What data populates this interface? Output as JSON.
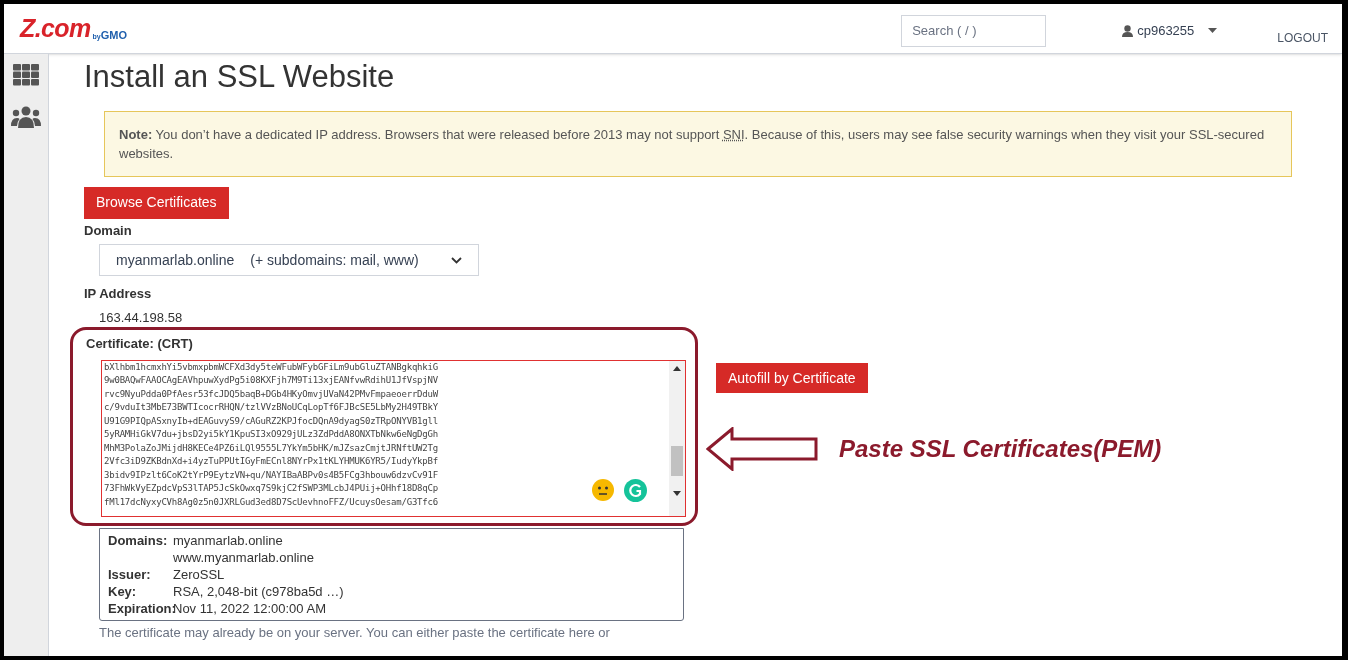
{
  "header": {
    "logo": {
      "main": "Z.com",
      "by": "by",
      "brand": "GMO"
    },
    "search": {
      "placeholder": "Search ( / )"
    },
    "user": "cp963255",
    "logout": "LOGOUT"
  },
  "title": "Install an SSL Website",
  "note": {
    "label": "Note:",
    "before": "You don’t have a dedicated IP address. Browsers that were released before 2013 may not support ",
    "abbr": "SNI",
    "after": ". Because of this, users may see false security warnings when they visit your SSL-secured websites."
  },
  "browse_button": "Browse Certificates",
  "domain": {
    "label": "Domain",
    "value": "myanmarlab.online",
    "suffix": "(+ subdomains: mail, www)"
  },
  "ip": {
    "label": "IP Address",
    "value": "163.44.198.58"
  },
  "certificate": {
    "label": "Certificate: (CRT)",
    "lines": [
      "bXlhbm1hcmxhYi5vbmxpbmWCFXd3dy5teWFubWFybGFiLm9ubGluZTANBgkqhkiG",
      "9w0BAQwFAAOCAgEAVhpuwXydPg5i08KXFjh7M9Ti13xjEANfvwRdihU1JfVspjNV",
      "rvc9NyuPdda0PfAesr53fcJDQ5baqB+DGb4HKyOmvjUVaN42PMvFmpaeoerrDduW",
      "c/9vduIt3MbE73BWTIcocrRHQN/tzlVVzBNoUCqLopTf6FJBcSE5LbMy2H49TBkY",
      "U91G9PIQpASxnyIb+dEAGuvyS9/cAGuRZ2KPJfocDQnA9dyagS0zTRpONYVB1gll",
      "5yRAMHiGkV7du+jbsD2yi5kY1KpuSI3xO929jULz3ZdPddA8ONXTbNkw6eNgDgGh",
      "MhM3PolaZoJMijdH8KECe4PZ6iLQl9555L7YkYm5bHK/mJZsazCmjtJRNftUW2Tg",
      "2Vfc3iD9ZKBdnXd+i4yzTuPPUtIGyFmECnl8NYrPx1tKLYHMUK6YR5/IudyYkpBf",
      "3bidv9IPzlt6CoK2tYrP9EytzVN+qu/NAYIBaABPv0s4B5FCg3hbouw6dzvCv91F",
      "73FhWkVyEZpdcVpS3lTAP5JcSkOwxq7S9kjC2fSWP3MLcbJ4PUij+OHhf18D8qCp",
      "fMl17dcNyxyCVh8Ag0z5n0JXRLGud3ed8D7ScUevhnoFFZ/UcuysOesam/G3Tfc6"
    ]
  },
  "autofill_button": "Autofill by Certificate",
  "annotation": "Paste SSL Certificates(PEM)",
  "details": [
    {
      "label": "Domains:",
      "values": [
        "myanmarlab.online",
        "www.myanmarlab.online"
      ]
    },
    {
      "label": "Issuer:",
      "values": [
        "ZeroSSL"
      ]
    },
    {
      "label": "Key:",
      "values": [
        "RSA, 2,048-bit (c978ba5d …)"
      ]
    },
    {
      "label": "Expiration:",
      "values": [
        "Nov 11, 2022 12:00:00 AM"
      ]
    }
  ],
  "footer_text": "The certificate may already be on your server. You can either paste the certificate here or"
}
